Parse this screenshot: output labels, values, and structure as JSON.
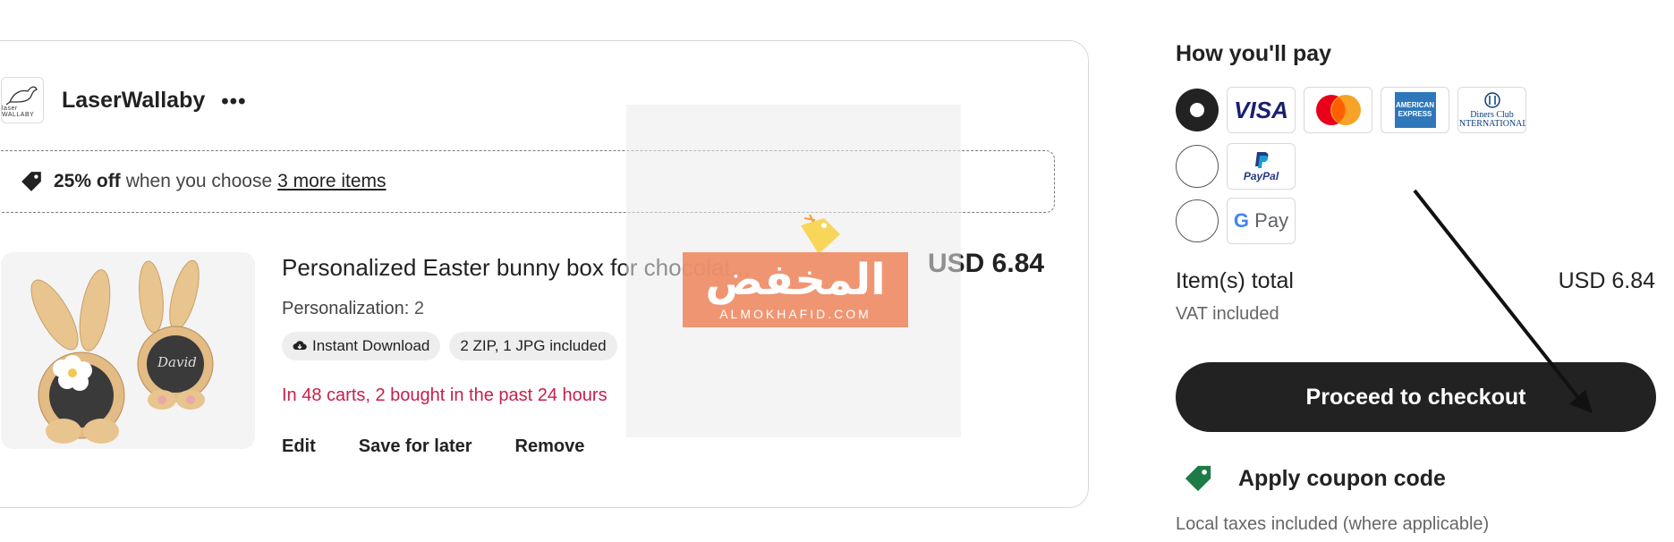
{
  "shop": {
    "logo_text": "laser WALLABY",
    "name": "LaserWallaby",
    "more_label": "•••"
  },
  "promo": {
    "bold": "25% off",
    "text": "when you choose",
    "link": "3 more items"
  },
  "item": {
    "title": "Personalized Easter bunny box for chocolat...",
    "price": "USD 6.84",
    "personalization_label": "Personalization:",
    "personalization_value": "2",
    "badges": [
      "Instant Download",
      "2 ZIP, 1 JPG included"
    ],
    "demand": "In 48 carts, 2 bought in the past 24 hours",
    "image_name_text": "David",
    "actions": [
      "Edit",
      "Save for later",
      "Remove"
    ]
  },
  "watermark": {
    "arabic": "المخفض",
    "english": "ALMOKHAFID.COM"
  },
  "payment": {
    "title": "How you'll pay",
    "options": [
      {
        "selected": true,
        "methods": [
          "visa",
          "mastercard",
          "american-express",
          "diners-club"
        ]
      },
      {
        "selected": false,
        "methods": [
          "paypal"
        ]
      },
      {
        "selected": false,
        "methods": [
          "google-pay"
        ]
      }
    ],
    "visa_label": "VISA",
    "amex_label": "AMERICAN EXPRESS",
    "diners_label": "Diners Club INTERNATIONAL",
    "paypal_label": "PayPal",
    "gpay_label": "Pay"
  },
  "summary": {
    "total_label": "Item(s) total",
    "total_value": "USD 6.84",
    "vat_note": "VAT included",
    "checkout_label": "Proceed to checkout",
    "coupon_label": "Apply coupon code",
    "local_tax_note": "Local taxes included (where applicable)"
  },
  "colors": {
    "accent_dark": "#222222",
    "demand_red": "#c71f4a",
    "coupon_green": "#1e7a46",
    "watermark_orange": "#ef8e68"
  }
}
